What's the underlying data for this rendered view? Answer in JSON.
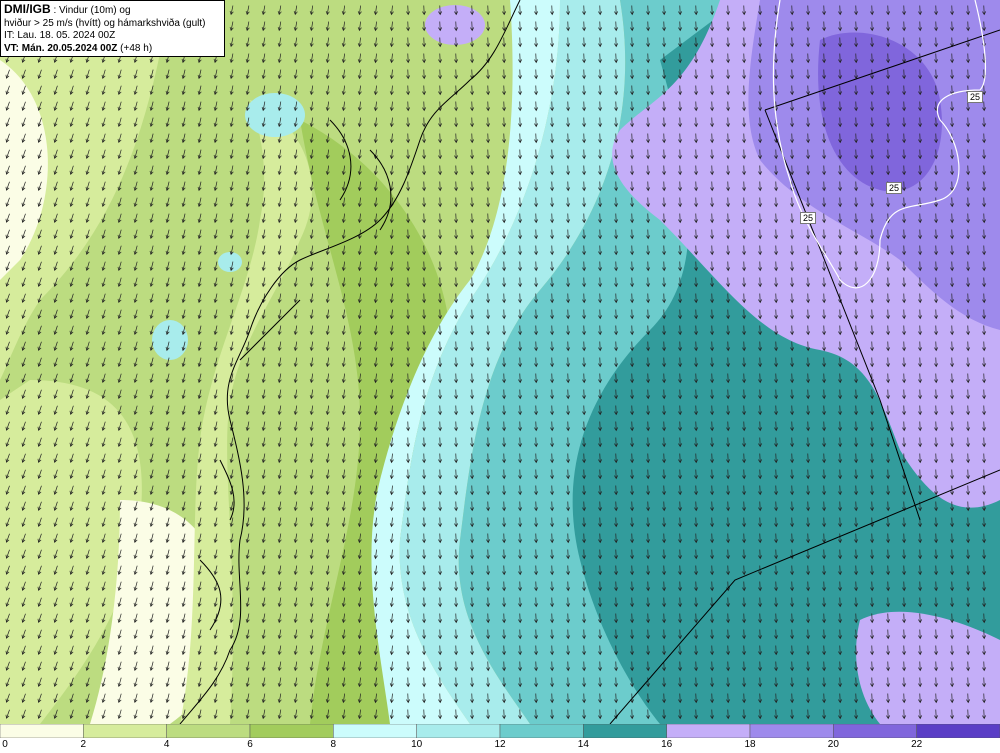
{
  "header": {
    "brand": "DMI/IGB",
    "line1_rest": ": Vindur (10m) og",
    "line2": "hviður > 25 m/s (hvítt) og hámarkshviða (gult)",
    "line3": "IT: Lau. 18. 05. 2024 00Z",
    "vt_label": "VT: Mán. 20.05.2024 00Z",
    "vt_suffix": " (+48 h)"
  },
  "contour_labels": [
    "25",
    "25",
    "25"
  ],
  "colorbar": {
    "ticks": [
      "0",
      "2",
      "4",
      "6",
      "8",
      "10",
      "12",
      "14",
      "16",
      "18",
      "20",
      "22"
    ],
    "colors": [
      "#fbfde6",
      "#d6ec9c",
      "#bcdc80",
      "#a2cc5c",
      "#ccfcfc",
      "#a8ecec",
      "#6ccccc",
      "#329c9c",
      "#c4aef8",
      "#9e8aec",
      "#8066dc",
      "#5a3ec6"
    ]
  },
  "legend_colors": {
    "land_calm": "#fbfde6",
    "land_light": "#d6ec9c",
    "land_mid": "#bcdc80",
    "sea_teal": "#329c9c",
    "gust_violet": "#9e8aec",
    "arrow": "#222222",
    "coast": "#000000",
    "gust_contour": "#ffffff"
  }
}
